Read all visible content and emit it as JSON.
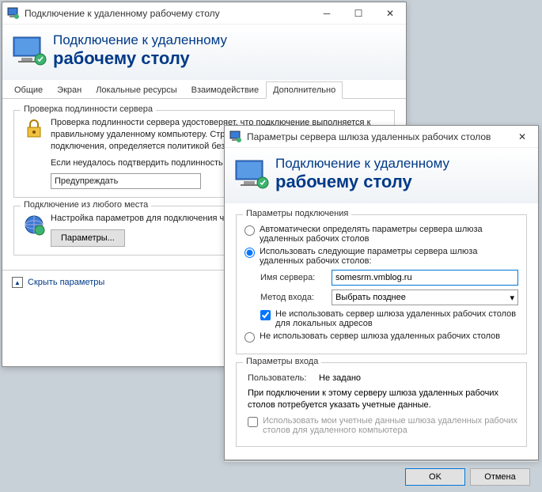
{
  "win1": {
    "title": "Подключение к удаленному рабочему столу",
    "banner1": "Подключение к удаленному",
    "banner2": "рабочему столу",
    "tabs": [
      "Общие",
      "Экран",
      "Локальные ресурсы",
      "Взаимодействие",
      "Дополнительно"
    ],
    "group1": {
      "legend": "Проверка подлинности сервера",
      "text1": "Проверка подлинности сервера удостоверяет, что подключение выполняется к правильному удаленному компьютеру. Строгость проверки, необходимая для подключения, определяется политикой безопасности системы.",
      "text2": "Если неудалось подтвердить подлинность удаленного компьютера:",
      "combo": "Предупреждать"
    },
    "group2": {
      "legend": "Подключение из любого места",
      "text": "Настройка параметров для подключения через шлюз при удаленной работе.",
      "button": "Параметры..."
    },
    "hide": "Скрыть параметры"
  },
  "win2": {
    "title": "Параметры сервера шлюза удаленных рабочих столов",
    "banner1": "Подключение к удаленному",
    "banner2": "рабочему столу",
    "group1": {
      "legend": "Параметры подключения",
      "radio1": "Автоматически определять параметры сервера шлюза удаленных рабочих столов",
      "radio2": "Использовать следующие параметры сервера шлюза удаленных рабочих столов:",
      "server_label": "Имя сервера:",
      "server_value": "somesrm.vmblog.ru",
      "method_label": "Метод входа:",
      "method_value": "Выбрать позднее",
      "check1": "Не использовать сервер шлюза удаленных рабочих столов для локальных адресов",
      "radio3": "Не использовать сервер шлюза удаленных рабочих столов"
    },
    "group2": {
      "legend": "Параметры входа",
      "user_label": "Пользователь:",
      "user_value": "Не задано",
      "text": "При подключении к этому серверу шлюза удаленных рабочих столов потребуется указать учетные данные.",
      "check": "Использовать мои учетные данные шлюза удаленных рабочих столов для удаленного компьютера"
    },
    "ok": "OK",
    "cancel": "Отмена"
  }
}
